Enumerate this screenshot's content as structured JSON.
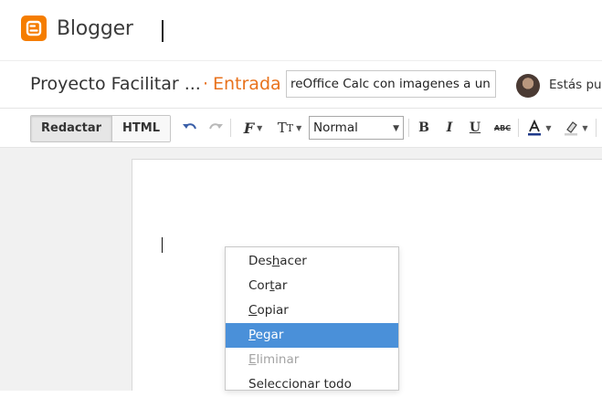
{
  "app": {
    "brand": "Blogger",
    "brand_color": "#f57d00"
  },
  "post": {
    "blog_name": "Proyecto Facilitar ...",
    "separator": "·",
    "section": "Entrada",
    "section_color": "#e8721c",
    "title_value": "reOffice Calc con imagenes a un pc",
    "status": "Estás pub"
  },
  "toolbar": {
    "mode_compose": "Redactar",
    "mode_html": "HTML",
    "undo_icon": "undo-icon",
    "redo_icon": "redo-icon",
    "font_icon": "font-family-icon",
    "font_size_icon": "font-size-icon",
    "format_value": "Normal",
    "bold": "B",
    "italic": "I",
    "underline": "U",
    "strike": "ABC"
  },
  "context_menu": {
    "items": [
      {
        "pre": "Des",
        "key": "h",
        "post": "acer",
        "state": "normal"
      },
      {
        "pre": "Cor",
        "key": "t",
        "post": "ar",
        "state": "normal"
      },
      {
        "pre": "",
        "key": "C",
        "post": "opiar",
        "state": "normal"
      },
      {
        "pre": "",
        "key": "P",
        "post": "egar",
        "state": "highlighted"
      },
      {
        "pre": "",
        "key": "E",
        "post": "liminar",
        "state": "disabled"
      },
      {
        "pre": "Seleccionar todo",
        "key": "",
        "post": "",
        "state": "normal"
      }
    ],
    "highlight_color": "#4a90d9"
  }
}
